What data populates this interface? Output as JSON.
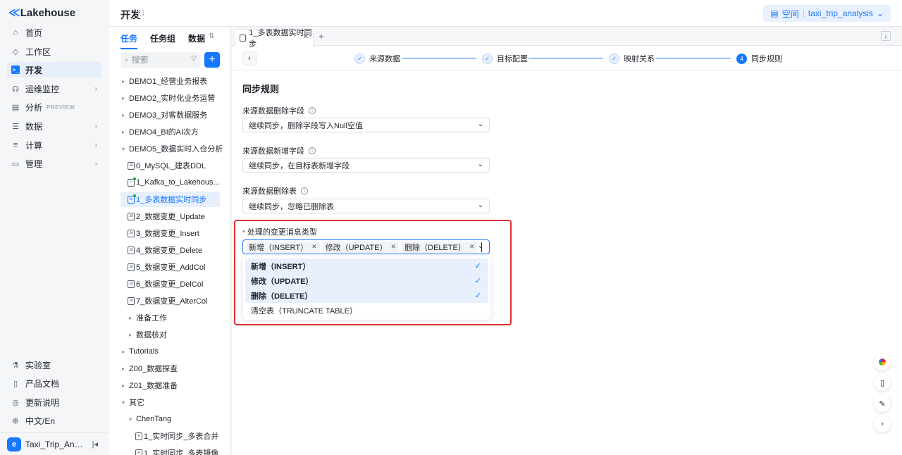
{
  "app": {
    "logo_mark": "≪",
    "logo_text": "Lakehouse"
  },
  "nav": {
    "items": [
      {
        "label": "首页",
        "icon": "home-icon",
        "glyph": "⌂"
      },
      {
        "label": "工作区",
        "icon": "cube-icon",
        "glyph": "◇"
      },
      {
        "label": "开发",
        "icon": "terminal-icon",
        "glyph": ">_"
      },
      {
        "label": "运维监控",
        "icon": "monitor-icon",
        "glyph": "☊"
      },
      {
        "label": "分析",
        "icon": "chart-icon",
        "glyph": "▤",
        "badge": "PREVIEW"
      },
      {
        "label": "数据",
        "icon": "database-icon",
        "glyph": "☰"
      },
      {
        "label": "计算",
        "icon": "compute-icon",
        "glyph": "≡"
      },
      {
        "label": "管理",
        "icon": "manage-icon",
        "glyph": "▭"
      }
    ],
    "bottom": [
      {
        "label": "实验室",
        "icon": "flask-icon",
        "glyph": "⚗"
      },
      {
        "label": "产品文档",
        "icon": "book-icon",
        "glyph": "▯"
      },
      {
        "label": "更新说明",
        "icon": "update-icon",
        "glyph": "◎"
      },
      {
        "label": "中文/En",
        "icon": "globe-icon",
        "glyph": "⊕"
      }
    ],
    "workspace": {
      "avatar": "e",
      "name": "Taxi_Trip_Anal..."
    }
  },
  "header": {
    "title": "开发",
    "space_label": "空间",
    "space_name": "taxi_trip_analysis"
  },
  "tree": {
    "tabs": [
      "任务",
      "任务组",
      "数据"
    ],
    "search_placeholder": "搜索",
    "rows": [
      {
        "label": "DEMO1_经营业务报表"
      },
      {
        "label": "DEMO2_实时化业务运营"
      },
      {
        "label": "DEMO3_对客数据服务"
      },
      {
        "label": "DEMO4_BI的AI次方"
      },
      {
        "label": "DEMO5_数据实时入仓分析"
      },
      {
        "label": "0_MySQL_建表DDL",
        "icon": "Jd"
      },
      {
        "label": "1_Kafka_to_Lakehous...",
        "icon": "✓"
      },
      {
        "label": "1_多表数据实时同步",
        "icon": "≣"
      },
      {
        "label": "2_数据变更_Update",
        "icon": "Jd"
      },
      {
        "label": "3_数据变更_Insert",
        "icon": "Jd"
      },
      {
        "label": "4_数据变更_Delete",
        "icon": "Jd"
      },
      {
        "label": "5_数据变更_AddCol",
        "icon": "Jd"
      },
      {
        "label": "6_数据变更_DelCol",
        "icon": "Jd"
      },
      {
        "label": "7_数据变更_AlterCol",
        "icon": "Jd"
      },
      {
        "label": "准备工作"
      },
      {
        "label": "数据核对"
      },
      {
        "label": "Tutorials"
      },
      {
        "label": "Z00_数据探查"
      },
      {
        "label": "Z01_数据准备"
      },
      {
        "label": "其它"
      },
      {
        "label": "ChenTang"
      },
      {
        "label": "1_实时同步_多表合并",
        "icon": "≣"
      },
      {
        "label": "1_实时同步_多表镜像",
        "icon": "≣"
      }
    ]
  },
  "main": {
    "tab_label": "1_多表数据实时同步",
    "steps": [
      {
        "label": "来源数据"
      },
      {
        "label": "目标配置"
      },
      {
        "label": "映射关系"
      },
      {
        "label": "同步规则",
        "number": "4"
      }
    ],
    "section_title": "同步规则",
    "fields": [
      {
        "label": "来源数据删除字段",
        "value": "继续同步，删除字段写入Null空值"
      },
      {
        "label": "来源数据新增字段",
        "value": "继续同步，在目标表新增字段"
      },
      {
        "label": "来源数据删除表",
        "value": "继续同步，忽略已删除表"
      }
    ],
    "msg_types": {
      "label": "处理的变更消息类型",
      "required_mark": "•",
      "tags": [
        "新增（INSERT）",
        "修改（UPDATE）",
        "删除（DELETE）"
      ],
      "options": [
        {
          "label": "新增（INSERT）",
          "selected": true
        },
        {
          "label": "修改（UPDATE）",
          "selected": true
        },
        {
          "label": "删除（DELETE）",
          "selected": true
        },
        {
          "label": "清空表（TRUNCATE TABLE）",
          "selected": false
        }
      ]
    }
  },
  "colors": {
    "accent": "#1677ff",
    "highlight": "#e03131",
    "selected_bg": "#e8f0fe"
  }
}
